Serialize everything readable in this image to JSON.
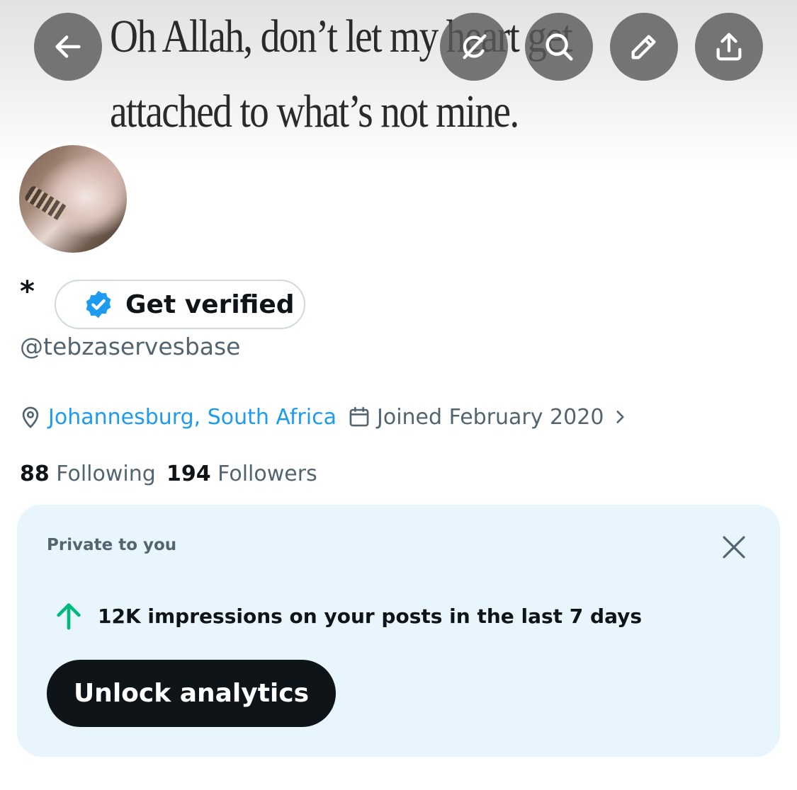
{
  "banner": {
    "line1": "Oh Allah, don’t let my heart get",
    "line2": "attached to what’s not mine."
  },
  "header_buttons": {
    "back": "arrow-left-icon",
    "grok": "grok-icon",
    "search": "search-icon",
    "edit": "pencil-icon",
    "share": "share-icon"
  },
  "profile": {
    "display_name": "*",
    "get_verified_label": "Get verified",
    "handle": "@tebzaservesbase",
    "location": "Johannesburg, South Africa",
    "joined": "Joined February 2020",
    "following_count": "88",
    "following_label": "Following",
    "followers_count": "194",
    "followers_label": "Followers"
  },
  "analytics_card": {
    "label": "Private to you",
    "impressions_text": "12K impressions on your posts in the last 7 days",
    "unlock_label": "Unlock analytics"
  },
  "colors": {
    "accent": "#1d9bf0",
    "secondary_text": "#536471",
    "card_bg": "#e8f5fd",
    "up_arrow": "#00ba7c",
    "dark_button": "#0f1419"
  }
}
